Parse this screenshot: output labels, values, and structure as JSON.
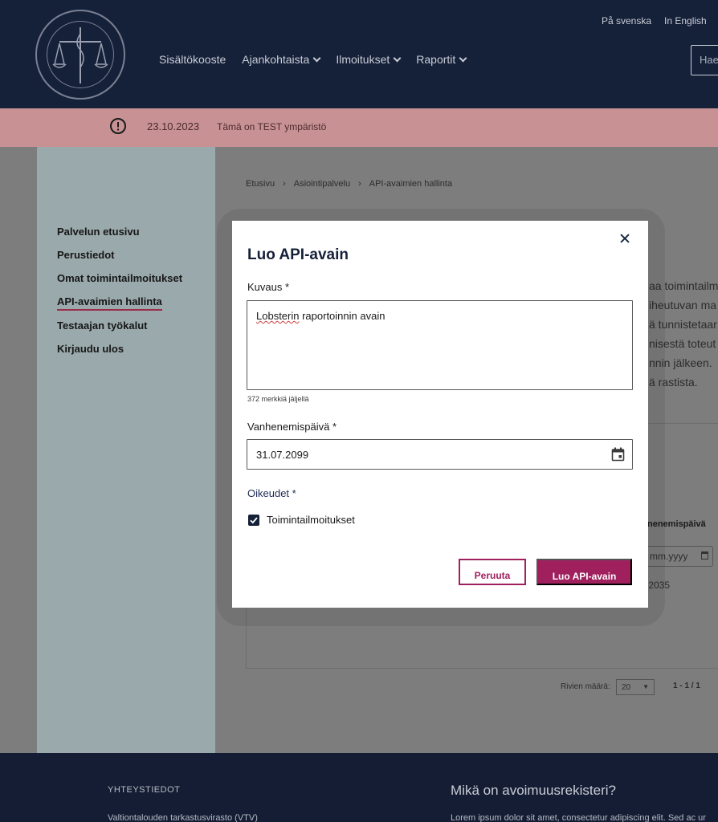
{
  "header": {
    "nav": [
      "Sisältökooste",
      "Ajankohtaista",
      "Ilmoitukset",
      "Raportit"
    ],
    "lang_sv": "På svenska",
    "lang_en": "In English",
    "search_placeholder": "Hae"
  },
  "banner": {
    "date": "23.10.2023",
    "text": "Tämä on TEST ympäristö",
    "color": "#c89294"
  },
  "sidebar": {
    "items": [
      "Palvelun etusivu",
      "Perustiedot",
      "Omat toimintailmoitukset",
      "API-avaimien hallinta",
      "Testaajan työkalut",
      "Kirjaudu ulos"
    ]
  },
  "breadcrumb": [
    "Etusivu",
    "Asiointipalvelu",
    "API-avaimien hallinta"
  ],
  "background_text": {
    "lines": [
      "aa toimintailm",
      "iheutuvan ma",
      "ä tunnistetaar",
      "nisestä toteut",
      "nnin jälkeen.",
      "ä rastista."
    ],
    "column_header": "nenemispäivä",
    "date_filter": "mm.yyyy",
    "cell_date": ".2035",
    "pager_label": "Rivien määrä:",
    "pager_value": "20",
    "pager_range": "1 - 1 / 1"
  },
  "modal": {
    "title": "Luo API-avain",
    "description_label": "Kuvaus *",
    "description_value": "Lobsterin raportoinnin avain",
    "description_spell_word": "Lobsterin",
    "description_rest": " raportoinnin avain",
    "counter": "372 merkkiä jäljellä",
    "expiry_label": "Vanhenemispäivä *",
    "expiry_value": "31.07.2099",
    "rights_label": "Oikeudet *",
    "rights_option": "Toimintailmoitukset",
    "rights_checked": true,
    "cancel_label": "Peruuta",
    "create_label": "Luo API-avain",
    "accent_color": "#a0205e"
  },
  "footer": {
    "contact_heading": "YHTEYSTIEDOT",
    "contact_text": "Valtiontalouden tarkastusvirasto (VTV)",
    "about_heading": "Mikä on avoimuusrekisteri?",
    "about_text": "Lorem ipsum dolor sit amet, consectetur adipiscing elit. Sed ac ur"
  }
}
